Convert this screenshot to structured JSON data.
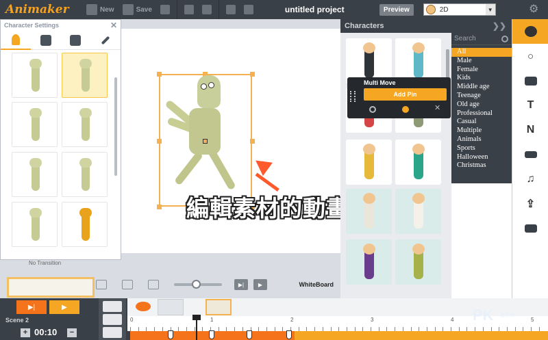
{
  "app": {
    "logo": "Animaker",
    "project_title": "untitled project"
  },
  "toolbar": {
    "new_label": "New",
    "save_label": "Save",
    "preview_label": "Preview",
    "mode_value": "2D"
  },
  "character_settings": {
    "title": "Character Settings",
    "tabs": [
      "actions-icon",
      "expressions-icon",
      "color-palette-icon",
      "magic-wand-icon"
    ],
    "selected_index": 1,
    "thumbnails": [
      "mummy-walk",
      "mummy-scared",
      "mummy-stand",
      "mummy-walk-2",
      "mummy-point",
      "mummy-run",
      "mummy-dance",
      "pharaoh"
    ]
  },
  "transition_label": "No Transition",
  "characters_panel": {
    "title": "Characters",
    "search_placeholder": "Search",
    "categories": [
      "All",
      "Male",
      "Female",
      "Kids",
      "Middle age",
      "Teenage",
      "Old age",
      "Professional",
      "Casual",
      "Multiple",
      "Animals",
      "Sports",
      "Halloween",
      "Christmas"
    ],
    "active_category": "All"
  },
  "multi_move": {
    "title": "Multi Move",
    "add_pin_label": "Add Pin"
  },
  "stage": {
    "whiteboard_label": "WhiteBoard",
    "annotation_text": "編輯素材的動畫效果"
  },
  "right_toolbar": [
    "character-icon",
    "lightbulb-icon",
    "image-icon",
    "text-icon",
    "number-icon",
    "video-icon",
    "music-note-icon",
    "upload-icon",
    "background-icon"
  ],
  "timeline": {
    "scene_label": "Scene 2",
    "time_value": "00:10",
    "ruler_marks": [
      "0",
      "1",
      "2",
      "3",
      "4",
      "5"
    ]
  },
  "watermark": {
    "main": "PK",
    "sub": "痞客邦"
  },
  "colors": {
    "accent_orange": "#f5a623",
    "timeline_orange": "#f5731b",
    "dark_chrome": "#3a4048"
  }
}
